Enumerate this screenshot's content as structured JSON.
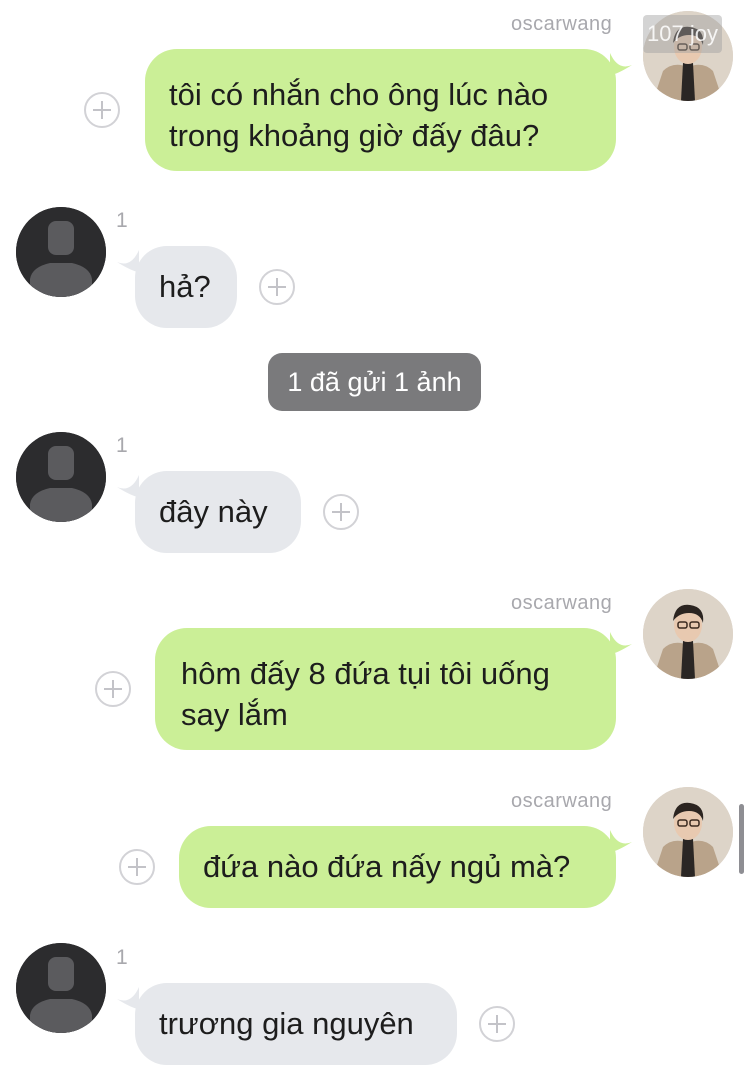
{
  "watermark": "107 joy",
  "messages": [
    {
      "sender": "oscarwang",
      "lines": [
        "tôi có nhắn cho ông lúc nào",
        "trong khoảng giờ đấy đâu?"
      ]
    },
    {
      "read": "1",
      "lines": [
        "hả?"
      ]
    },
    {
      "notice": "1 đã gửi 1 ảnh"
    },
    {
      "read": "1",
      "lines": [
        "đây này"
      ]
    },
    {
      "sender": "oscarwang",
      "lines": [
        "hôm đấy 8 đứa tụi tôi uống",
        "say lắm"
      ]
    },
    {
      "sender": "oscarwang",
      "lines": [
        "đứa nào đứa nấy ngủ mà?"
      ]
    },
    {
      "read": "1",
      "lines": [
        "trương gia nguyên"
      ]
    }
  ],
  "icons": {
    "add": "add-reaction-icon",
    "placeholder_avatar": "default-person-avatar",
    "user_avatar": "profile-photo-avatar"
  },
  "colors": {
    "outgoing_bubble": "#cbef97",
    "incoming_bubble": "#e6e8ec",
    "notice_bg": "#7a7a7c",
    "meta_text": "#a8a8ad"
  }
}
